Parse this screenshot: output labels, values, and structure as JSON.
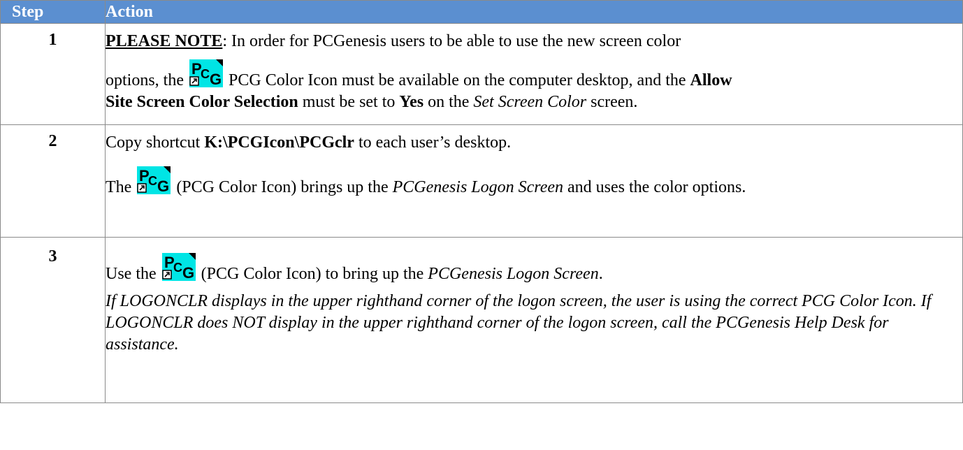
{
  "table": {
    "header": {
      "step": "Step",
      "action": "Action"
    },
    "rows": [
      {
        "num": "1",
        "line1_bold": "PLEASE NOTE",
        "line1_rest": ":  In order for PCGenesis users to be able to use the new screen color",
        "line2_pre": "options, the ",
        "line2_post": " PCG Color Icon must be available on the computer desktop, and the ",
        "line2_bold": "Allow",
        "line3_bold1": "Site Screen Color Selection",
        "line3_mid": " must be set to ",
        "line3_bold2": "Yes",
        "line3_mid2": " on the ",
        "line3_italic": "Set Screen Color",
        "line3_end": " screen."
      },
      {
        "num": "2",
        "a_pre": "Copy shortcut ",
        "a_bold": "K:\\PCGIcon\\PCGclr",
        "a_post": " to each user’s desktop.",
        "b_pre": "The ",
        "b_post": " (PCG Color Icon) brings up the ",
        "b_italic": "PCGenesis Logon Screen",
        "b_end": " and uses the color options."
      },
      {
        "num": "3",
        "a_pre": "Use the ",
        "a_post": " (PCG Color Icon) to bring up the ",
        "a_italic": "PCGenesis Logon Screen",
        "a_end": ".",
        "b_italic": "If LOGONCLR displays in the upper righthand corner of the logon screen, the user is using the correct PCG Color Icon.  If LOGONCLR does NOT display in the upper righthand corner of the logon screen, call the PCGenesis Help Desk for assistance."
      }
    ]
  },
  "icon": {
    "name": "pcg-color-icon",
    "label_top": "P",
    "label_c": "C",
    "label_g": "G",
    "bg": "#00e5e5",
    "fg": "#000000"
  },
  "colors": {
    "header_bg": "#5b8fd0",
    "header_text": "#ffffff",
    "border": "#8a8a8a"
  }
}
